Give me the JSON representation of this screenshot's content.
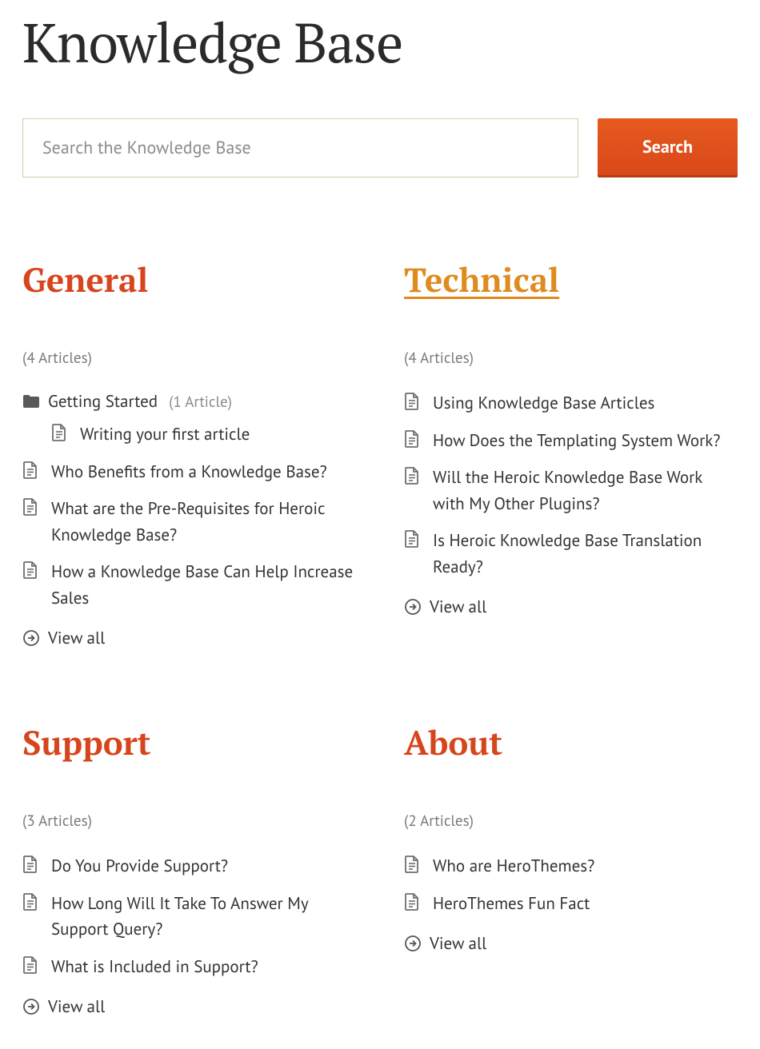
{
  "page_title": "Knowledge Base",
  "search": {
    "placeholder": "Search the Knowledge Base",
    "button_label": "Search"
  },
  "view_all_label": "View all",
  "categories": [
    {
      "title": "General",
      "highlighted": false,
      "count_label": "(4 Articles)",
      "subcategory": {
        "name": "Getting Started",
        "count_label": "(1 Article)",
        "articles": [
          "Writing your first article"
        ]
      },
      "articles": [
        "Who Benefits from a Knowledge Base?",
        "What are the Pre-Requisites for Heroic Knowledge Base?",
        "How a Knowledge Base Can Help Increase Sales"
      ]
    },
    {
      "title": "Technical",
      "highlighted": true,
      "count_label": "(4 Articles)",
      "articles": [
        "Using Knowledge Base Articles",
        "How Does the Templating System Work?",
        "Will the Heroic Knowledge Base Work with My Other Plugins?",
        "Is Heroic Knowledge Base Translation Ready?"
      ]
    },
    {
      "title": "Support",
      "highlighted": false,
      "count_label": "(3 Articles)",
      "articles": [
        "Do You Provide Support?",
        "How Long Will It Take To Answer My Support Query?",
        "What is Included in Support?"
      ]
    },
    {
      "title": "About",
      "highlighted": false,
      "count_label": "(2 Articles)",
      "articles": [
        "Who are HeroThemes?",
        "HeroThemes Fun Fact"
      ]
    }
  ]
}
